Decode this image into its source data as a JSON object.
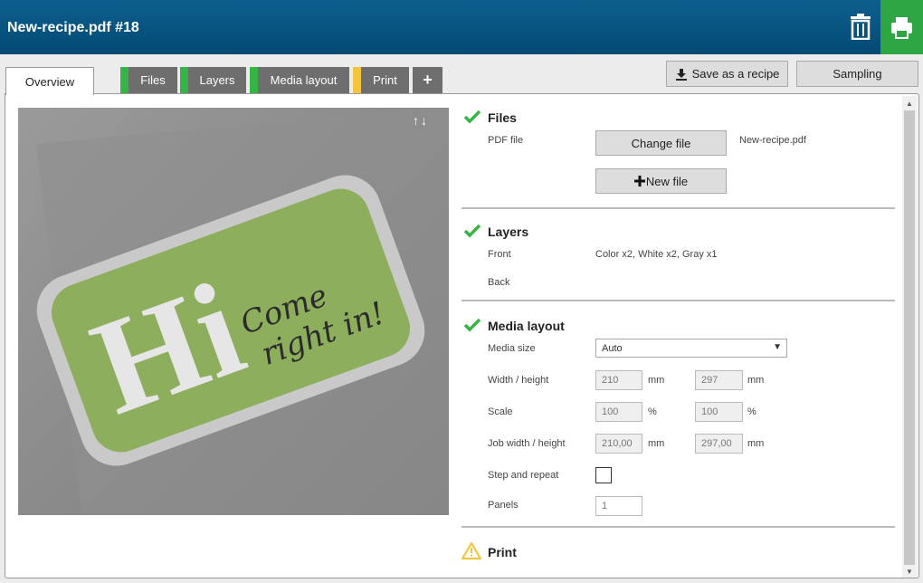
{
  "header": {
    "title": "New-recipe.pdf #18",
    "trash_icon": "trash-icon",
    "print_icon": "printer-icon"
  },
  "tabs": [
    {
      "label": "Overview",
      "status_color": ""
    },
    {
      "label": "Files",
      "status_color": "#35b545"
    },
    {
      "label": "Layers",
      "status_color": "#35b545"
    },
    {
      "label": "Media layout",
      "status_color": "#35b545"
    },
    {
      "label": "Print",
      "status_color": "#f2c53d"
    },
    {
      "label": "+"
    }
  ],
  "actions": {
    "save_recipe": "Save as a recipe",
    "sampling": "Sampling"
  },
  "preview": {
    "arrows": "↑↓",
    "title_text": "Hi",
    "tagline_line1": "Come",
    "tagline_line2": "right in!"
  },
  "files": {
    "title": "Files",
    "pdf_label": "PDF file",
    "change_button": "Change file",
    "filename": "New-recipe.pdf",
    "new_button": "New file"
  },
  "layers": {
    "title": "Layers",
    "front_label": "Front",
    "front_value": "Color x2, White x2, Gray x1",
    "back_label": "Back"
  },
  "media_layout": {
    "title": "Media layout",
    "media_size_label": "Media size",
    "media_size_value": "Auto",
    "wh_label": "Width / height",
    "width": "210",
    "height": "297",
    "mm": "mm",
    "scale_label": "Scale",
    "scale_x": "100",
    "scale_y": "100",
    "pct": "%",
    "job_wh_label": "Job width / height",
    "job_width": "210,00",
    "job_height": "297,00",
    "step_repeat_label": "Step and repeat",
    "panels_label": "Panels",
    "panels": "1"
  },
  "print": {
    "title": "Print"
  },
  "colors": {
    "accent": "#0e5f8e",
    "green": "#2ea644",
    "ok": "#35b545",
    "warn": "#f2c53d"
  }
}
